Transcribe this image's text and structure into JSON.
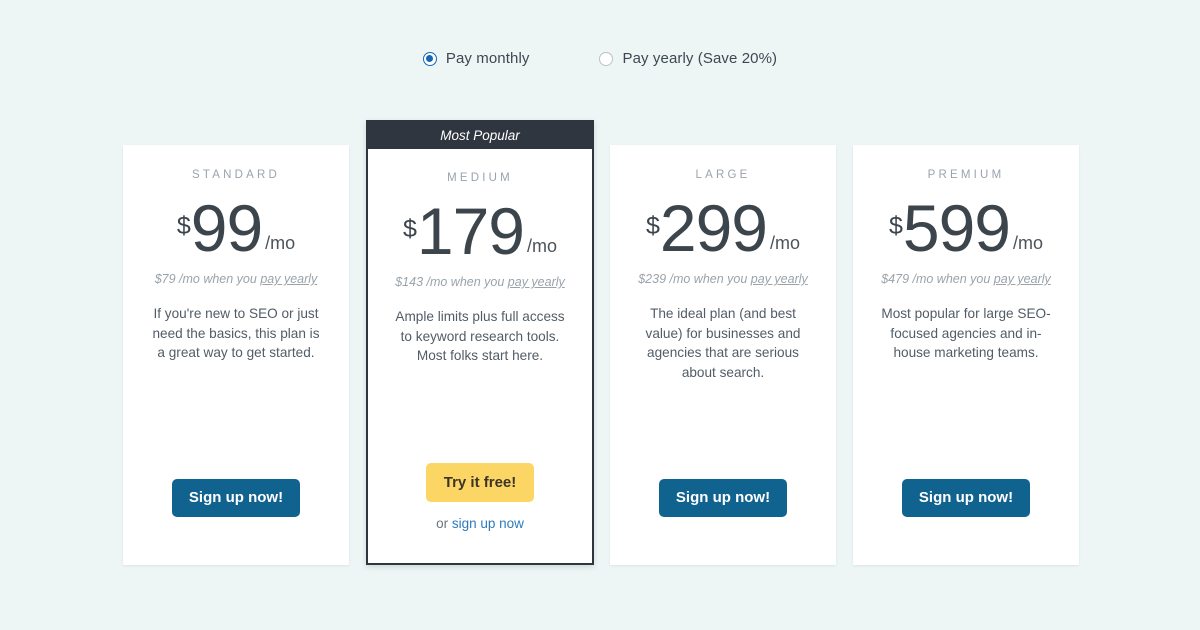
{
  "billing": {
    "options": [
      {
        "label": "Pay monthly",
        "selected": true
      },
      {
        "label": "Pay yearly (Save 20%)",
        "selected": false
      }
    ]
  },
  "colors": {
    "page_background": "#edf6f5",
    "card_background": "#ffffff",
    "featured_bar": "#2f3640",
    "primary_button": "#10628f",
    "trial_button": "#fbd664",
    "link": "#2b7bbd",
    "radio_selected": "#1668b3",
    "plan_name": "#9aa3ad"
  },
  "featured_badge": "Most Popular",
  "plans": [
    {
      "name": "STANDARD",
      "currency": "$",
      "price": "99",
      "per": "/mo",
      "yearly_prefix": "$79 /mo when you ",
      "yearly_link": "pay yearly",
      "description": "If you're new to SEO or just need the basics, this plan is a great way to get started.",
      "cta_label": "Sign up now!",
      "featured": false
    },
    {
      "name": "MEDIUM",
      "currency": "$",
      "price": "179",
      "per": "/mo",
      "yearly_prefix": "$143 /mo when you ",
      "yearly_link": "pay yearly",
      "description": "Ample limits plus full access to keyword research tools. Most folks start here.",
      "cta_label": "Try it free!",
      "sub_prefix": "or ",
      "sub_link": "sign up now",
      "featured": true
    },
    {
      "name": "LARGE",
      "currency": "$",
      "price": "299",
      "per": "/mo",
      "yearly_prefix": "$239 /mo when you ",
      "yearly_link": "pay yearly",
      "description": "The ideal plan (and best value) for businesses and agencies that are serious about search.",
      "cta_label": "Sign up now!",
      "featured": false
    },
    {
      "name": "PREMIUM",
      "currency": "$",
      "price": "599",
      "per": "/mo",
      "yearly_prefix": "$479 /mo when you ",
      "yearly_link": "pay yearly",
      "description": "Most popular for large SEO-focused agencies and in-house marketing teams.",
      "cta_label": "Sign up now!",
      "featured": false
    }
  ]
}
